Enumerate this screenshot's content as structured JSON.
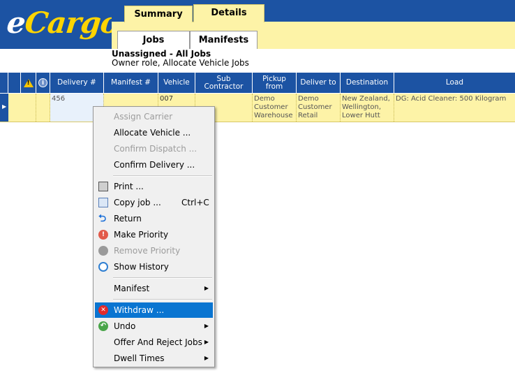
{
  "logo": {
    "text_e": "e",
    "text_rest": "Cargo"
  },
  "tabs": {
    "top": [
      "Summary",
      "Details"
    ],
    "sub": [
      "Jobs",
      "Manifests"
    ]
  },
  "view": {
    "title": "Unassigned - All Jobs",
    "subtitle": "Owner role, Allocate Vehicle Jobs"
  },
  "grid": {
    "columns": [
      "Delivery #",
      "Manifest #",
      "Vehicle",
      "Sub Contractor",
      "Pickup from",
      "Deliver to",
      "Destination",
      "Load"
    ],
    "row": {
      "indicator": "▶",
      "delivery": "456",
      "manifest": "",
      "vehicle": "007",
      "sub_contractor": "",
      "pickup_from": "Demo Customer Warehouse",
      "deliver_to": "Demo Customer Retail",
      "destination": "New Zealand, Wellington, Lower Hutt",
      "load": "DG: Acid Cleaner: 500 Kilogram"
    }
  },
  "menu": {
    "items": [
      {
        "label": "Assign Carrier",
        "disabled": true
      },
      {
        "label": "Allocate Vehicle ..."
      },
      {
        "label": "Confirm Dispatch ...",
        "disabled": true
      },
      {
        "label": "Confirm Delivery ..."
      },
      {
        "label": "Print ...",
        "icon": "printer-icon"
      },
      {
        "label": "Copy job ...",
        "shortcut": "Ctrl+C",
        "icon": "copy-icon"
      },
      {
        "label": "Return",
        "icon": "return-arrow-icon"
      },
      {
        "label": "Make Priority",
        "icon": "priority-icon"
      },
      {
        "label": "Remove Priority",
        "disabled": true,
        "icon": "remove-priority-icon"
      },
      {
        "label": "Show History",
        "icon": "clock-icon"
      },
      {
        "label": "Manifest",
        "submenu": true
      },
      {
        "label": "Withdraw ...",
        "icon": "withdraw-icon",
        "selected": true
      },
      {
        "label": "Undo",
        "submenu": true,
        "icon": "undo-icon"
      },
      {
        "label": "Offer And Reject Jobs",
        "submenu": true
      },
      {
        "label": "Dwell Times",
        "submenu": true
      }
    ]
  },
  "colors": {
    "header_blue": "#1c53a3",
    "row_yellow": "#fdf3a7",
    "logo_yellow": "#ffd400",
    "selection": "#0a75d1"
  }
}
